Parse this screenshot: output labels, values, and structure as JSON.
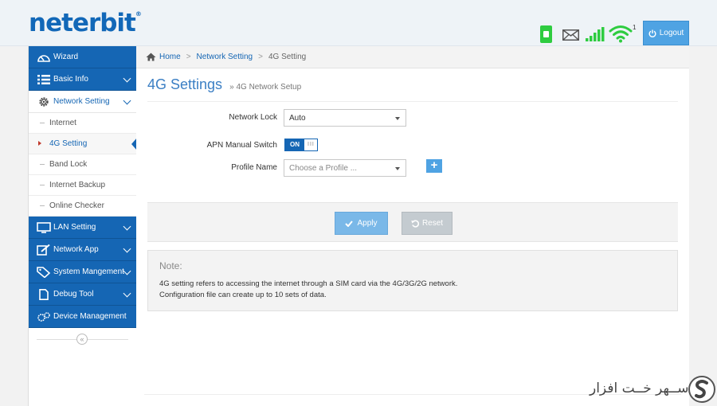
{
  "brand": {
    "logo_text": "neterbit",
    "logo_mark": "®"
  },
  "header": {
    "status_icons": [
      "sim-card-icon",
      "mail-icon",
      "signal-bars-icon",
      "wifi-icon"
    ],
    "wifi_clients": "1",
    "logout_label": "Logout",
    "colors": {
      "sim": "#2ecc40",
      "signal": "#2ecc40",
      "wifi": "#2ecc40",
      "logout": "#4fa3e3"
    }
  },
  "sidebar": {
    "items": [
      {
        "label": "Wizard",
        "icon": "speedometer-icon"
      },
      {
        "label": "Basic Info",
        "icon": "list-icon"
      },
      {
        "label": "Network Setting",
        "icon": "gear-icon",
        "open": true,
        "children": [
          {
            "label": "Internet"
          },
          {
            "label": "4G Setting",
            "active": true
          },
          {
            "label": "Band Lock"
          },
          {
            "label": "Internet Backup"
          },
          {
            "label": "Online Checker"
          }
        ]
      },
      {
        "label": "LAN Setting",
        "icon": "monitor-icon"
      },
      {
        "label": "Network App",
        "icon": "edit-icon"
      },
      {
        "label": "System Mangement",
        "icon": "tag-icon"
      },
      {
        "label": "Debug Tool",
        "icon": "document-icon"
      },
      {
        "label": "Device Management",
        "icon": "gears-icon"
      }
    ],
    "collapse_glyph": "«",
    "accent": "#1566b4"
  },
  "breadcrumb": {
    "home": "Home",
    "section": "Network Setting",
    "current": "4G Setting",
    "separator": ">"
  },
  "page": {
    "title": "4G Settings",
    "subtitle": "» 4G Network Setup"
  },
  "form": {
    "network_lock": {
      "label": "Network Lock",
      "value": "Auto"
    },
    "apn_switch": {
      "label": "APN Manual Switch",
      "state": "ON",
      "grip": "III"
    },
    "profile_name": {
      "label": "Profile Name",
      "placeholder": "Choose a Profile ...",
      "add_glyph": "+"
    }
  },
  "actions": {
    "apply": "Apply",
    "reset": "Reset"
  },
  "note": {
    "title": "Note:",
    "lines": [
      "4G setting refers to accessing the internet through a SIM card via the 4G/3G/2G network.",
      "Configuration file can create up to 10 sets of data."
    ]
  },
  "watermark": {
    "text": "ســهر خــت افزار"
  }
}
